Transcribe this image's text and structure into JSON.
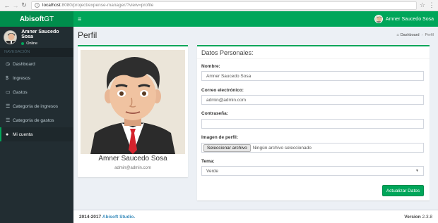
{
  "browser": {
    "host": "localhost",
    "path": ":8080/project/expense-manager/?view=profile"
  },
  "header": {
    "logo_bold": "Abisoft",
    "logo_light": "GT",
    "user_name": "Amner Saucedo Sosa"
  },
  "sidebar": {
    "user_name": "Amner Saucedo Sosa",
    "status": "Online",
    "section": "NAVEGACIÓN",
    "items": [
      {
        "label": "Dashboard",
        "icon": "dashboard-icon",
        "glyph": "◷"
      },
      {
        "label": "Ingresos",
        "icon": "dollar-icon",
        "glyph": "$"
      },
      {
        "label": "Gastos",
        "icon": "card-icon",
        "glyph": "▭"
      },
      {
        "label": "Categoría de ingresos",
        "icon": "list-icon",
        "glyph": "☰"
      },
      {
        "label": "Categoría de gastos",
        "icon": "list-icon",
        "glyph": "☰"
      },
      {
        "label": "Mi cuenta",
        "icon": "user-icon",
        "glyph": "●"
      }
    ]
  },
  "content": {
    "title": "Perfil",
    "breadcrumb_home": "Dashboard",
    "breadcrumb_current": "Perfil"
  },
  "profile": {
    "name": "Amner Saucedo Sosa",
    "email": "admin@admin.com"
  },
  "form": {
    "title": "Datos Personales:",
    "name_label": "Nombre:",
    "name_value": "Amner Saucedo Sosa",
    "email_label": "Correo electrónico:",
    "email_value": "admin@admin.com",
    "password_label": "Contraseña:",
    "password_value": "",
    "image_label": "Imagen de perfil:",
    "file_button": "Seleccionar archivo",
    "file_none": "Ningún archivo seleccionado",
    "theme_label": "Tema:",
    "theme_value": "Verde",
    "submit": "Actualizar Datos"
  },
  "footer": {
    "copyright": "2014-2017",
    "brand": "Abisoft Studio.",
    "version_label": "Version",
    "version_value": "2.3.8"
  },
  "colors": {
    "accent": "#00a65a",
    "accent_dark": "#008d4c",
    "sidebar_bg": "#222d32",
    "link": "#3c8dbc"
  }
}
